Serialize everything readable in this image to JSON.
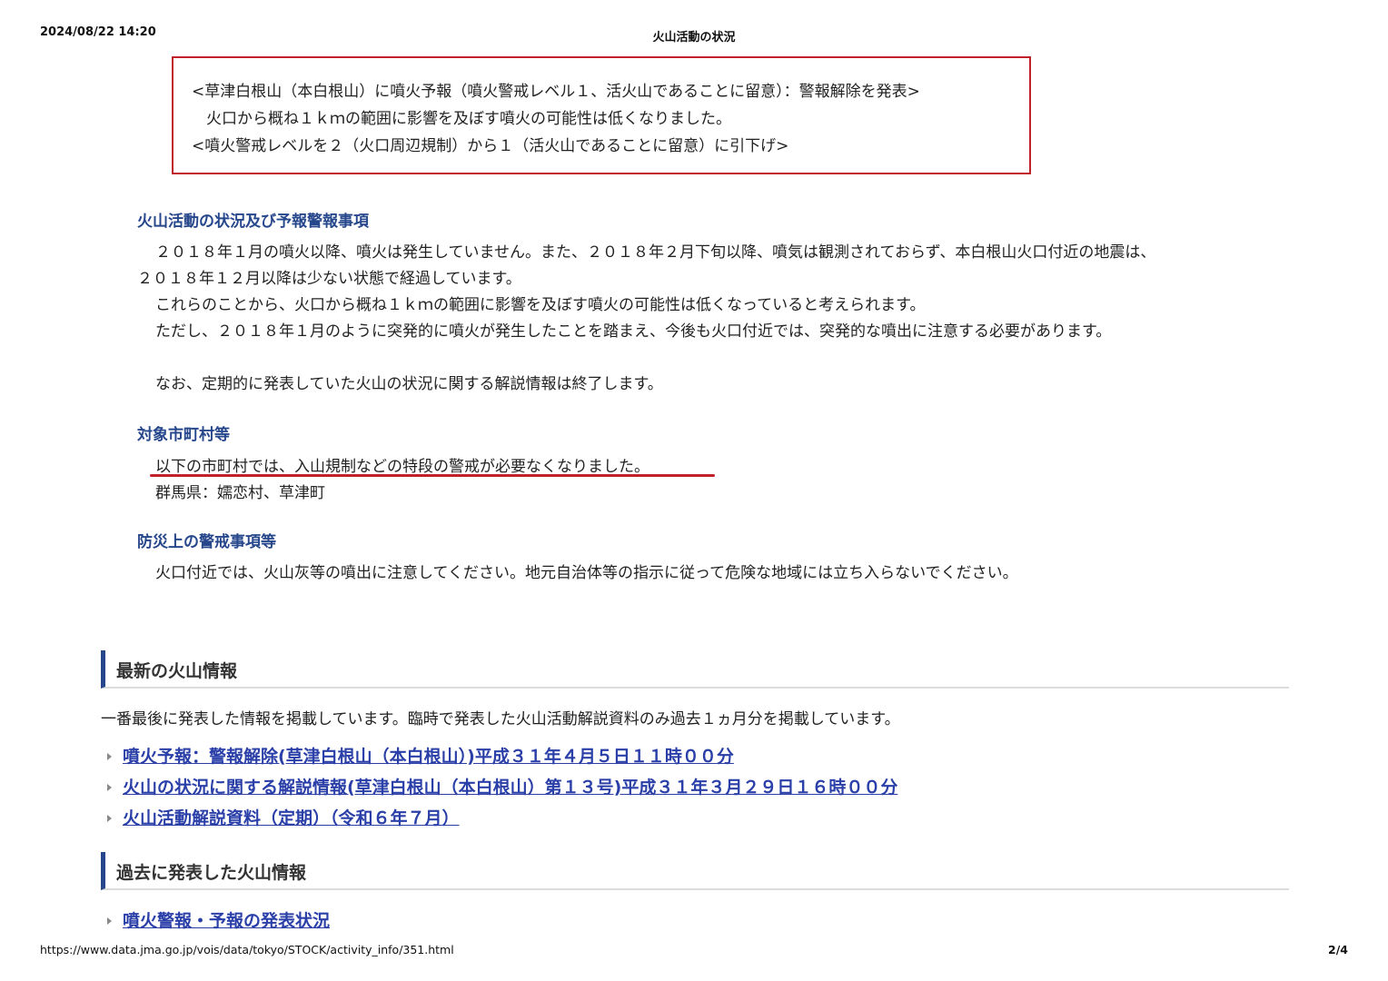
{
  "page_header": {
    "datetime": "2024/08/22 14:20",
    "title": "火山活動の状況"
  },
  "notice_box": {
    "line1": "<草津白根山（本白根山）に噴火予報（噴火警戒レベル１、活火山であることに留意）：警報解除を発表>",
    "line2": "火口から概ね１ｋｍの範囲に影響を及ぼす噴火の可能性は低くなりました。",
    "line3": "<噴火警戒レベルを２（火口周辺規制）から１（活火山であることに留意）に引下げ>"
  },
  "activity_section": {
    "title": "火山活動の状況及び予報警報事項",
    "p1_line1": "２０１８年１月の噴火以降、噴火は発生していません。また、２０１８年２月下旬以降、噴気は観測されておらず、本白根山火口付近の地震は、",
    "p1_line2": "２０１８年１２月以降は少ない状態で経過しています。",
    "p2": "これらのことから、火口から概ね１ｋｍの範囲に影響を及ぼす噴火の可能性は低くなっていると考えられます。",
    "p3": "ただし、２０１８年１月のように突発的に噴火が発生したことを踏まえ、今後も火口付近では、突発的な噴出に注意する必要があります。",
    "p4": "なお、定期的に発表していた火山の状況に関する解説情報は終了します。"
  },
  "municipality_section": {
    "title": "対象市町村等",
    "line1": "以下の市町村では、入山規制などの特段の警戒が必要なくなりました。",
    "line2": "群馬県：嬬恋村、草津町"
  },
  "disaster_section": {
    "title": "防災上の警戒事項等",
    "line1": "火口付近では、火山灰等の噴出に注意してください。地元自治体等の指示に従って危険な地域には立ち入らないでください。"
  },
  "latest_info": {
    "heading": "最新の火山情報",
    "description": "一番最後に発表した情報を掲載しています。臨時で発表した火山活動解説資料のみ過去１ヵ月分を掲載しています。",
    "links": [
      "噴火予報：警報解除(草津白根山（本白根山）)平成３１年４月５日１１時００分",
      "火山の状況に関する解説情報(草津白根山（本白根山）第１３号)平成３１年３月２９日１６時００分",
      "火山活動解説資料（定期）（令和６年７月）"
    ]
  },
  "past_info": {
    "heading": "過去に発表した火山情報",
    "links": [
      "噴火警報・予報の発表状況"
    ]
  },
  "page_footer": {
    "url": "https://www.data.jma.go.jp/vois/data/tokyo/STOCK/activity_info/351.html",
    "page": "2/4"
  },
  "colors": {
    "accent_red": "#c0212a",
    "section_blue": "#27478c",
    "link_blue": "#2a3fa8"
  }
}
